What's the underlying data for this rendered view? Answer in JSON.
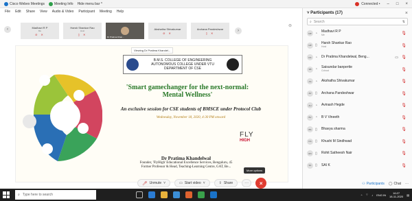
{
  "window": {
    "tabs": [
      {
        "label": "Cisco Webex Meetings"
      },
      {
        "label": "Meeting Info"
      },
      {
        "label": "Hide menu bar ^"
      }
    ],
    "connection": "Connected •"
  },
  "menu": [
    "File",
    "Edit",
    "Share",
    "View",
    "Audio & Video",
    "Participant",
    "Meeting",
    "Help"
  ],
  "thumbnails": [
    {
      "name": "Madhavi R P",
      "sub": "Me"
    },
    {
      "name": "Harsh Shankar Rao",
      "sub": "Host"
    },
    {
      "name": "Dr Pratima Khan...",
      "sub": ""
    },
    {
      "name": "Akshatha Shivakumar",
      "sub": ""
    },
    {
      "name": "Archana Pandeshwar",
      "sub": ""
    }
  ],
  "slide": {
    "viewing": "Viewing Dr Pratima Khandel...",
    "college_line1": "B.M.S. COLLEGE OF ENGINEERING",
    "college_line2": "AUTONOMOUS COLLEGE UNDER VTU",
    "college_line3": "DEPARTMENT OF CSE",
    "headline1": "'Smart gamechanger for the next-normal:",
    "headline2": "Mental Wellness'",
    "subline": "An exclusive session for CSE students of BMSCE under Protocol Club",
    "date": "Wednesday, November 18, 2020, 4:30 PM onward",
    "fly": "FLY",
    "high": "HIGH",
    "speaker_name": "Dr Pratima Khandelwal",
    "speaker_role1": "Founder, 'FlyHigh' Educational Excellence Services, Bengaluru, 45",
    "speaker_role2": "Former Professor  & Head, Teaching-Learning Centre, GAT, Be..."
  },
  "controls": {
    "unmute": "Unmute",
    "start_video": "Start video",
    "share": "Share",
    "more": "···",
    "end": "×",
    "tooltip": "More options"
  },
  "panel": {
    "title": "Participants (17)",
    "search_placeholder": "Search",
    "participants": [
      {
        "initials": "MP",
        "name": "Madhavi R P",
        "role": "Me"
      },
      {
        "initials": "HR",
        "name": "Harsh Shankar Rao",
        "role": "Host"
      },
      {
        "initials": "DK",
        "name": "Dr Pratima Khandelwal, Beng...",
        "role": ""
      },
      {
        "initials": "SB",
        "name": "Saisundar banpertte",
        "role": "Cohost"
      },
      {
        "initials": "AS",
        "name": "Akshatha Shivakumar",
        "role": ""
      },
      {
        "initials": "AP",
        "name": "Archana Pandeshwar",
        "role": ""
      },
      {
        "initials": "AH",
        "name": "Avinash Hegde",
        "role": ""
      },
      {
        "initials": "BV",
        "name": "B V Vineeth",
        "role": ""
      },
      {
        "initials": "BS",
        "name": "Bhavya sharma",
        "role": ""
      },
      {
        "initials": "KS",
        "name": "Khushi M Sindhwad",
        "role": ""
      },
      {
        "initials": "RN",
        "name": "Rohit Satheesh Nair",
        "role": ""
      },
      {
        "initials": "SK",
        "name": "SAI K",
        "role": ""
      }
    ],
    "participants_btn": "Participants",
    "chat_btn": "Chat"
  },
  "taskbar": {
    "search_placeholder": "Type here to search",
    "lang": "ENG IN",
    "time": "16:27",
    "date": "18-11-2020"
  },
  "colors": {
    "accent": "#1a73c9",
    "end_call": "#e03c31",
    "mute": "#d32f2f",
    "headline": "#2a7a2a"
  }
}
